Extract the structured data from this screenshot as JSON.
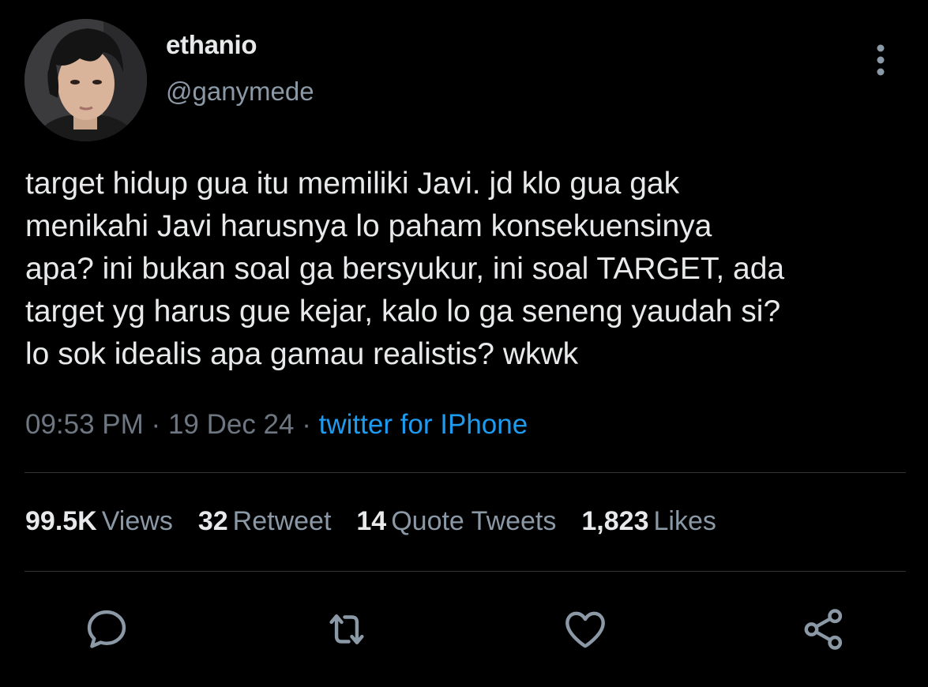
{
  "author": {
    "display_name": "ethanio",
    "handle": "@ganymede",
    "avatar_icon": "avatar"
  },
  "tweet": {
    "lines": [
      "target hidup gua itu memiliki Javi. jd klo gua gak",
      "menikahi Javi harusnya lo paham konsekuensinya",
      "apa? ini bukan soal ga bersyukur, ini soal TARGET, ada",
      "target yg harus gue kejar, kalo lo ga seneng yaudah si?",
      "lo sok idealis apa gamau realistis? wkwk"
    ],
    "time": "09:53 PM",
    "separator": "·",
    "date": "19 Dec 24",
    "source": "twitter for IPhone"
  },
  "stats": {
    "views_count": "99.5K",
    "views_label": "Views",
    "retweets_count": "32",
    "retweets_label": "Retweet",
    "quotes_count": "14",
    "quotes_label": "Quote Tweets",
    "likes_count": "1,823",
    "likes_label": "Likes"
  },
  "actions": [
    "reply-icon",
    "retweet-icon",
    "like-icon",
    "share-icon"
  ],
  "colors": {
    "background": "#000000",
    "text": "#e7e9ea",
    "secondary": "#8b98a5",
    "link": "#1d9bf0",
    "divider": "#2f3336"
  }
}
